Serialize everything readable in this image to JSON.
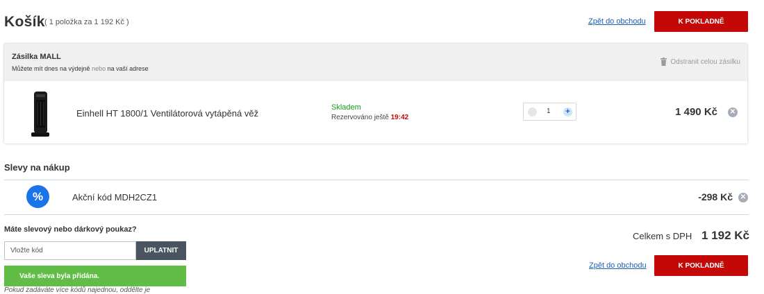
{
  "header": {
    "title": "Košík",
    "subtitle": "( 1 položka za 1 192 Kč )",
    "back_link": "Zpět do obchodu",
    "checkout_label": "K POKLADNĚ"
  },
  "shipment": {
    "title": "Zásilka MALL",
    "note_part1": "Můžete mít dnes na výdejně",
    "note_part2": "nebo",
    "note_part3": "na vaší adrese",
    "remove_all_label": "Odstranit celou zásilku",
    "item": {
      "name": "Einhell HT 1800/1 Ventilátorová vytápěná věž",
      "stock": "Skladem",
      "reserved_label": "Rezervováno ještě",
      "reserved_time": "19:42",
      "quantity": "1",
      "price": "1 490 Kč"
    }
  },
  "discounts": {
    "heading": "Slevy na nákup",
    "icon_text": "%",
    "items": [
      {
        "name": "Akční kód MDH2CZ1",
        "price": "-298 Kč"
      }
    ]
  },
  "voucher": {
    "label": "Máte slevový nebo dárkový poukaz?",
    "placeholder": "Vložte kód",
    "apply_label": "UPLATNIT",
    "success_message": "Vaše sleva byla přidána.",
    "hint": "Pokud zadáváte více kódů najednou, oddělte je"
  },
  "summary": {
    "total_label": "Celkem s DPH",
    "total_value": "1 192 Kč",
    "back_link": "Zpět do obchodu",
    "checkout_label": "K POKLADNĚ"
  },
  "icons": {
    "remove_all": "trash-icon",
    "remove_item": "close-icon",
    "remove_discount": "close-icon",
    "discount": "percent-icon",
    "qty_minus": "minus-icon",
    "qty_plus": "plus-icon"
  },
  "colors": {
    "accent_red": "#c40808",
    "link_blue": "#1a5db4",
    "success_green": "#62bd47",
    "stock_green": "#1a9c1a",
    "discount_blue": "#1a73e8"
  }
}
